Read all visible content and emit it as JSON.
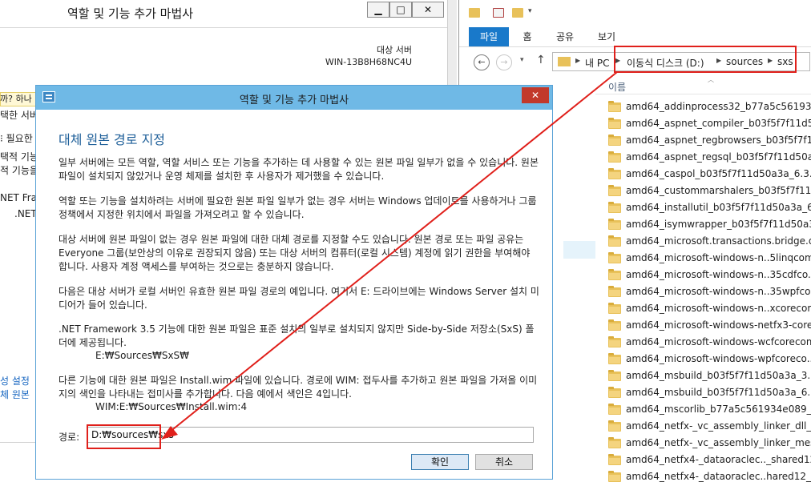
{
  "bg_wizard": {
    "title": "역할 및 기능 추가 마법사",
    "window_buttons": {
      "minimize": "▁",
      "maximize": "□",
      "close": "✕"
    },
    "destination_label": "대상 서버",
    "destination_server": "WIN-13B8H68NC4U",
    "warning_fragment": "까? 하나",
    "left_items": [
      "택한 서버",
      "필요한",
      "택적 기능",
      "적 기능을",
      "NET Fram",
      ".NET",
      "성 설정",
      "체 원본"
    ]
  },
  "explorer": {
    "ribbon_tabs": [
      "파일",
      "홈",
      "공유",
      "보기"
    ],
    "nav": {
      "back": "←",
      "forward": "→",
      "recent": "▾",
      "up": "↑"
    },
    "address_crumbs": [
      "내 PC",
      "이동식 디스크 (D:)",
      "sources",
      "sxs"
    ],
    "column_header": "이름",
    "files": [
      "amd64_addinprocess32_b77a5c561934...",
      "amd64_aspnet_compiler_b03f5f7f11d50...",
      "amd64_aspnet_regbrowsers_b03f5f7f11...",
      "amd64_aspnet_regsql_b03f5f7f11d50a3...",
      "amd64_caspol_b03f5f7f11d50a3a_6.3.9...",
      "amd64_custommarshalers_b03f5f7f11d...",
      "amd64_installutil_b03f5f7f11d50a3a_6....",
      "amd64_isymwrapper_b03f5f7f11d50a3a_...",
      "amd64_microsoft.transactions.bridge.dt...",
      "amd64_microsoft-windows-n..5linqcom...",
      "amd64_microsoft-windows-n..35cdfco...",
      "amd64_microsoft-windows-n..35wpfco...",
      "amd64_microsoft-windows-n..xcorecom...",
      "amd64_microsoft-windows-netfx3-core...",
      "amd64_microsoft-windows-wcfcorecom...",
      "amd64_microsoft-windows-wpfcoreco...",
      "amd64_msbuild_b03f5f7f11d50a3a_3.5....",
      "amd64_msbuild_b03f5f7f11d50a3a_6.3....",
      "amd64_mscorlib_b77a5c561934e089_6...",
      "amd64_netfx-_vc_assembly_linker_dll_b0...",
      "amd64_netfx-_vc_assembly_linker_mess...",
      "amd64_netfx4-_dataoraclec.._shared12_...",
      "amd64_netfx4-_dataoraclec..hared12_ne..."
    ]
  },
  "dialog": {
    "title": "역할 및 기능 추가 마법사",
    "close": "✕",
    "heading": "대체 원본 경로 지정",
    "paragraphs": [
      "일부 서버에는 모든 역할, 역할 서비스 또는 기능을 추가하는 데 사용할 수 있는 원본 파일 일부가 없을 수 있습니다. 원본 파일이 설치되지 않았거나 운영 체제를 설치한 후 사용자가 제거했을 수 있습니다.",
      "역할 또는 기능을 설치하려는 서버에 필요한 원본 파일 일부가 없는 경우 서버는 Windows 업데이트를 사용하거나 그룹 정책에서 지정한 위치에서 파일을 가져오려고 할 수 있습니다.",
      "대상 서버에 원본 파일이 없는 경우 원본 파일에 대한 대체 경로를 지정할 수도 있습니다. 원본 경로 또는 파일 공유는 Everyone 그룹(보안상의 이유로 권장되지 않음) 또는 대상 서버의 컴퓨터(로컬 시스템) 계정에 읽기 권한을 부여해야 합니다. 사용자 계정 액세스를 부여하는 것으로는 충분하지 않습니다.",
      "다음은 대상 서버가 로컬 서버인 유효한 원본 파일 경로의 예입니다. 여기서 E: 드라이브에는 Windows Server 설치 미디어가 들어 있습니다.",
      ".NET Framework 3.5 기능에 대한 원본 파일은 표준 설치의 일부로 설치되지 않지만 Side-by-Side 저장소(SxS) 폴더에 제공됩니다.",
      "다른 기능에 대한 원본 파일은 Install.wim 파일에 있습니다. 경로에 WIM: 접두사를 추가하고 원본 파일을 가져올 이미지의 색인을 나타내는 접미사를 추가합니다. 다음 예에서 색인은 4입니다."
    ],
    "example_sxs": "E:₩Sources₩SxS₩",
    "example_wim": "WIM:E:₩Sources₩Install.wim:4",
    "path_label": "경로:",
    "path_value": "D:₩sources₩sxs",
    "ok_label": "확인",
    "cancel_label": "취소"
  },
  "colors": {
    "dialog_title": "#6fb9e6",
    "heading": "#1e5f99",
    "ribbon_active": "#1979ca",
    "annotation": "#e0201b",
    "close_button": "#c2392b"
  }
}
